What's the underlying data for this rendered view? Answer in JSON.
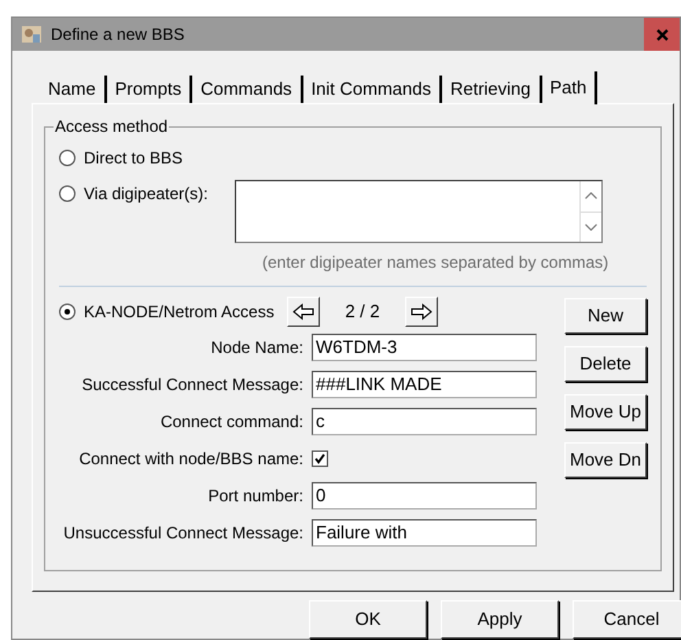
{
  "window": {
    "title": "Define a new BBS"
  },
  "tabs": [
    {
      "label": "Name",
      "selected": false
    },
    {
      "label": "Prompts",
      "selected": false
    },
    {
      "label": "Commands",
      "selected": false
    },
    {
      "label": "Init Commands",
      "selected": false
    },
    {
      "label": "Retrieving",
      "selected": false
    },
    {
      "label": "Path",
      "selected": true
    }
  ],
  "access_method": {
    "title": "Access method",
    "direct": {
      "label": "Direct to BBS",
      "selected": false
    },
    "digipeater": {
      "label": "Via digipeater(s):",
      "selected": false,
      "note": "(enter digipeater names separated by commas)"
    },
    "node": {
      "label": "KA-NODE/Netrom Access",
      "selected": true,
      "counter": "2 / 2",
      "fields": [
        {
          "kind": "text",
          "label": "Node Name:",
          "value": "W6TDM-3"
        },
        {
          "kind": "text",
          "label": "Successful Connect Message:",
          "value": "###LINK MADE"
        },
        {
          "kind": "text",
          "label": "Connect command:",
          "value": "c"
        },
        {
          "kind": "checkbox",
          "label": "Connect with node/BBS name:",
          "checked": true
        },
        {
          "kind": "text",
          "label": "Port number:",
          "value": "0"
        },
        {
          "kind": "text",
          "label": "Unsuccessful Connect Message:",
          "value": "Failure with"
        }
      ],
      "buttons": [
        "New",
        "Delete",
        "Move Up",
        "Move Dn"
      ]
    }
  },
  "buttons": [
    "OK",
    "Apply",
    "Cancel"
  ]
}
